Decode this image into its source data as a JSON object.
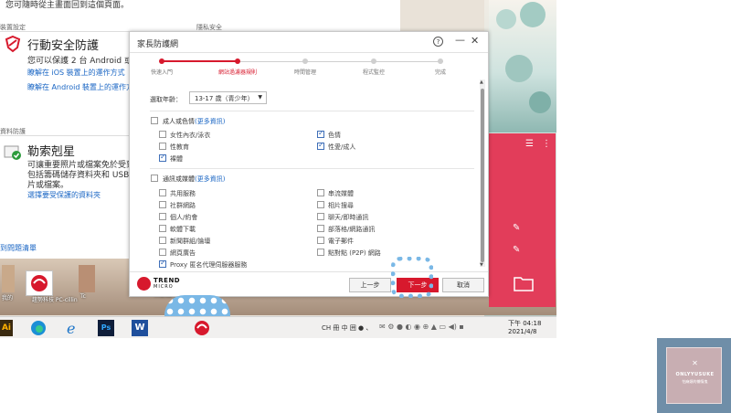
{
  "background_app": {
    "top_text": "您可隨時從主畫面回到這個頁面。",
    "section_left_1": "裝置設定",
    "section_right_1": "隱私安全",
    "mobile_title": "行動安全防護",
    "mobile_desc": "您可以保護 2 台 Android 或 iO",
    "link_ios": "瞭解在 iOS 裝置上的運作方式",
    "link_android": "瞭解在 Android 裝置上的運作方",
    "section_left_2": "資料防護",
    "ransom_title": "勒索剋星",
    "ransom_desc_1": "可讓重要照片或檔案免於受到",
    "ransom_desc_2": "包括籌碼儲存資料夾和 USB 儲",
    "ransom_desc_3": "片或檔案。",
    "link_folders": "選擇要受保護的資料夾",
    "bottom_link": "到問題清單"
  },
  "dialog": {
    "title": "家長防護網",
    "help": "?",
    "minimize": "—",
    "close": "✕",
    "steps": [
      {
        "label": "快速入門",
        "done": true
      },
      {
        "label": "網站過濾器規則",
        "done": true,
        "active": true
      },
      {
        "label": "時間管理",
        "done": false
      },
      {
        "label": "程式監控",
        "done": false
      },
      {
        "label": "完成",
        "done": false
      }
    ],
    "age_label": "選取年齡：",
    "age_value": "13-17 歲（青少年）",
    "group1": {
      "label": "成人或色情",
      "more": "(更多資訊)",
      "checked": false,
      "items": [
        {
          "label": "女性內衣/泳衣",
          "checked": false
        },
        {
          "label": "色情",
          "checked": true
        },
        {
          "label": "性教育",
          "checked": false
        },
        {
          "label": "性愛/成人",
          "checked": true
        },
        {
          "label": "裸體",
          "checked": true
        }
      ]
    },
    "group2": {
      "label": "通訊或媒體",
      "more": "(更多資訊)",
      "checked": false,
      "items": [
        {
          "label": "共用服務",
          "checked": false
        },
        {
          "label": "串流媒體",
          "checked": false
        },
        {
          "label": "社群網路",
          "checked": false
        },
        {
          "label": "相片搜尋",
          "checked": false
        },
        {
          "label": "個人/約會",
          "checked": false
        },
        {
          "label": "聊天/即時通訊",
          "checked": false
        },
        {
          "label": "軟體下載",
          "checked": false
        },
        {
          "label": "部落格/網路通訊",
          "checked": false
        },
        {
          "label": "新聞群組/論壇",
          "checked": false
        },
        {
          "label": "電子郵件",
          "checked": false
        },
        {
          "label": "網頁廣告",
          "checked": false
        },
        {
          "label": "點對點 (P2P) 網路",
          "checked": false
        },
        {
          "label": "Proxy 匿名代理伺服器服務",
          "checked": true
        }
      ]
    },
    "logo_line1": "TREND",
    "logo_line2": "MICRO",
    "btn_prev": "上一步",
    "btn_next": "下一步",
    "btn_cancel": "取消"
  },
  "desktop": {
    "icon_label_1": "我的",
    "icon_label_2": "趨勢科技 PC-cillin",
    "icon_label_3": "Tc",
    "icon_label_4": "TREND MICRO"
  },
  "taskbar": {
    "tray_text": "CH 冊 中 囲 ● 、",
    "clock_time": "下午 04:18",
    "clock_date": "2021/4/8"
  },
  "watermark": {
    "mark": "✕",
    "name": "ONLYYUSUKE",
    "sub": "怕麻煩的懶惰鬼"
  },
  "colors": {
    "accent_red": "#d7192d",
    "side_panel": "#e23d5a",
    "link_blue": "#1a66c4"
  }
}
